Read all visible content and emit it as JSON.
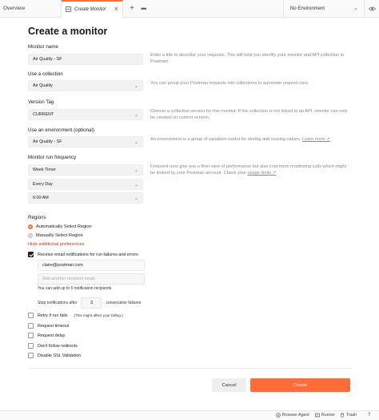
{
  "tabs": {
    "overview": "Overview",
    "active": "Create Monitor",
    "close_glyph": "×",
    "add_glyph": "+",
    "more_glyph": "•••"
  },
  "environment": {
    "selected": "No Environment"
  },
  "page_title": "Create a monitor",
  "monitor_name": {
    "label": "Monitor name",
    "value": "Air Quality - SF",
    "help": "Enter a title to describe your requests. This will help you identify your monitor and API collection in Postman."
  },
  "collection": {
    "label": "Use a collection",
    "value": "Air Quality",
    "help": "You can group your Postman requests into collections to automate request runs."
  },
  "version_tag": {
    "label": "Version Tag",
    "value": "CURRENT",
    "help": "Choose a collection version for this monitor. If the collection is not linked to an API, monitor can only be created on current version."
  },
  "env_field": {
    "label": "Use an environment (optional)",
    "value": "Air Quality - SF",
    "help": "An environment is a group of variables useful for storing and reusing values.",
    "help_link": "Learn more ↗"
  },
  "frequency": {
    "label": "Monitor run frequency",
    "timer": "Week Timer",
    "day": "Every Day",
    "time": "6:00 AM",
    "help": "Frequent runs give you a finer view of performance but also cost more monitoring calls which might be limited by your Postman account. Check your",
    "help_link": "usage limits ↗"
  },
  "regions": {
    "label": "Regions",
    "options": [
      {
        "label": "Automatically Select Region",
        "selected": true
      },
      {
        "label": "Manually Select Region",
        "selected": false
      }
    ]
  },
  "hide_preferences": "Hide additional preferences",
  "email_notifications": {
    "label": "Receive email notifications for run failures and errors",
    "checked": true,
    "recipient": "claire@postman.com",
    "add_placeholder": "Add another recipient email",
    "note": "You can add up to 5 notification recipients",
    "stop_label": "Stop notifications after",
    "stop_value": "3",
    "stop_suffix": "consecutive failures"
  },
  "options": [
    {
      "label": "Retry if run fails",
      "hint": "(This might affect your billing.)",
      "checked": false
    },
    {
      "label": "Request timeout",
      "hint": "",
      "checked": false
    },
    {
      "label": "Request delay",
      "hint": "",
      "checked": false
    },
    {
      "label": "Don't follow redirects",
      "hint": "",
      "checked": false
    },
    {
      "label": "Disable SSL Validation",
      "hint": "",
      "checked": false
    }
  ],
  "buttons": {
    "cancel": "Cancel",
    "create": "Create"
  },
  "statusbar": {
    "browser_agent": "Browser Agent",
    "runner": "Runner",
    "trash": "Trash",
    "help_glyph": "?"
  },
  "colors": {
    "accent": "#ff6c37",
    "link_red": "#c0391b"
  }
}
